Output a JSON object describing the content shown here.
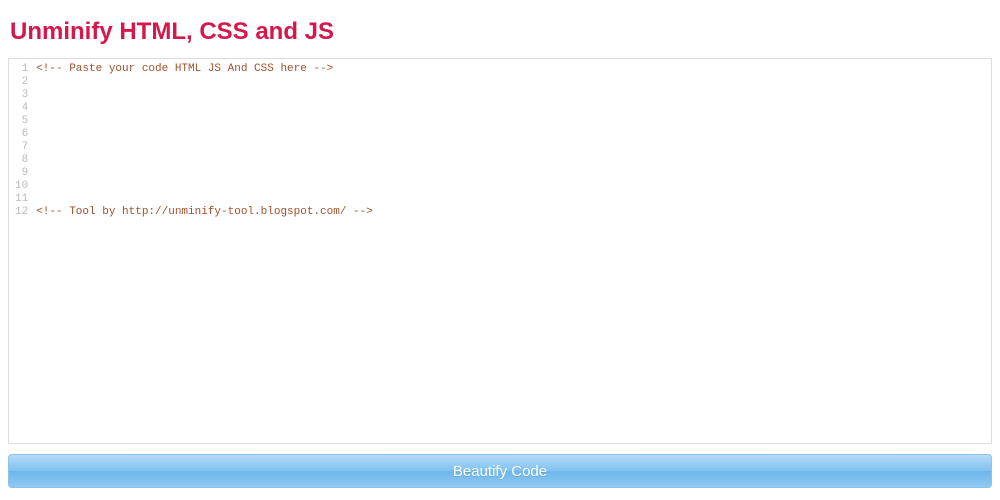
{
  "header": {
    "title": "Unminify HTML, CSS and JS"
  },
  "editor": {
    "line_count": 12,
    "lines": [
      "<!-- Paste your code HTML JS And CSS here -->",
      "",
      "",
      "",
      "",
      "",
      "",
      "",
      "",
      "",
      "",
      "<!-- Tool by http://unminify-tool.blogspot.com/ -->"
    ]
  },
  "actions": {
    "beautify_label": "Beautify Code"
  },
  "colors": {
    "title": "#d6174b",
    "code_text": "#a0522d",
    "button_top": "#b5dcf7",
    "button_bottom": "#6db6ea"
  }
}
